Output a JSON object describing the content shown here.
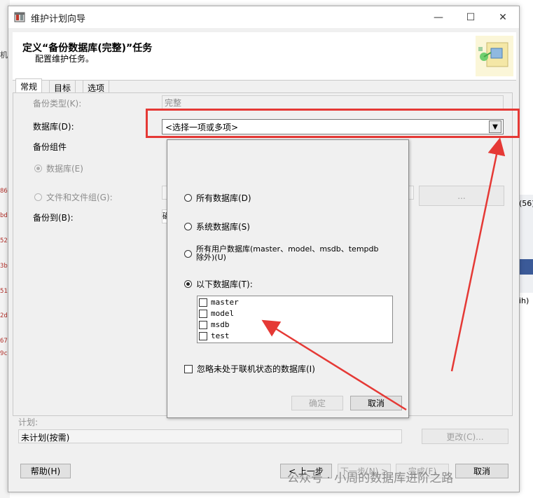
{
  "window": {
    "title": "维护计划向导",
    "controls": {
      "minimize": "—",
      "maximize": "☐",
      "close": "✕"
    }
  },
  "header": {
    "title": "定义“备份数据库(完整)”任务",
    "subtitle": "配置维护任务。"
  },
  "tabs": [
    {
      "label": "常规",
      "active": true
    },
    {
      "label": "目标",
      "active": false
    },
    {
      "label": "选项",
      "active": false
    }
  ],
  "form": {
    "backup_type_label": "备份类型(K):",
    "backup_type_value": "完整",
    "database_label": "数据库(D):",
    "database_value": "<选择一项或多项>",
    "backup_component_label": "备份组件",
    "radio_database": "数据库(E)",
    "radio_files": "文件和文件组(G):",
    "browse_button": "...",
    "backup_to_label": "备份到(B):",
    "backup_to_value": "磁"
  },
  "dropdown": {
    "option_all": "所有数据库(D)",
    "option_system": "系统数据库(S)",
    "option_user": "所有用户数据库(master、model、msdb、tempdb 除外)(U)",
    "option_these": "以下数据库(T):",
    "selected_option": "option_these",
    "databases": [
      "master",
      "model",
      "msdb",
      "test"
    ],
    "ignore_offline": "忽略未处于联机状态的数据库(I)",
    "ok_button": "确定",
    "cancel_button": "取消"
  },
  "schedule": {
    "label": "计划:",
    "value": "未计划(按需)",
    "change_button": "更改(C)..."
  },
  "footer": {
    "help_button": "帮助(H)",
    "back_button": "< 上一步",
    "next_button": "下一步(N) >",
    "finish_button": "完成(F)",
    "cancel_button": "取消"
  },
  "background": {
    "left_marks": [
      "机",
      "86",
      "bd",
      "52",
      "3b",
      "51",
      "2d",
      "67",
      "9c"
    ],
    "right_marks": [
      "(56)",
      "ih)"
    ]
  },
  "watermark": "公众号 · 小周的数据库进阶之路",
  "colors": {
    "annotation_red": "#e53935"
  }
}
